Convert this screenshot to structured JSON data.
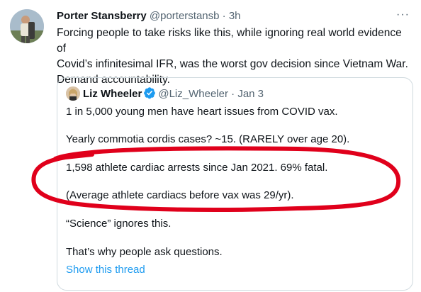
{
  "tweet": {
    "author_name": "Porter Stansberry",
    "author_handle": "@porterstansb",
    "separator": "·",
    "time": "3h",
    "more_label": "···",
    "lines": [
      "Forcing people to take risks like this, while ignoring real world evidence of",
      "Covid’s infinitesimal IFR, was the worst gov decision since Vietnam War.",
      "Demand accountability."
    ]
  },
  "quote": {
    "author_name": "Liz Wheeler",
    "author_handle": "@Liz_Wheeler",
    "separator": "·",
    "date": "Jan 3",
    "lines": [
      "1 in 5,000 young men have heart issues from COVID vax.",
      "Yearly commotia cordis cases? ~15. (RARELY over age 20).",
      "1,598 athlete cardiac arrests since Jan 2021. 69% fatal.",
      "(Average athlete cardiacs before vax was 29/yr).",
      "“Science” ignores this.",
      "That’s why people ask questions."
    ],
    "show_thread_label": "Show this thread"
  },
  "colors": {
    "text": "#0f1419",
    "secondary": "#536471",
    "link": "#1d9bf0",
    "verified": "#1d9bf0",
    "annotation": "#e0001b",
    "border": "#cfd9de"
  }
}
